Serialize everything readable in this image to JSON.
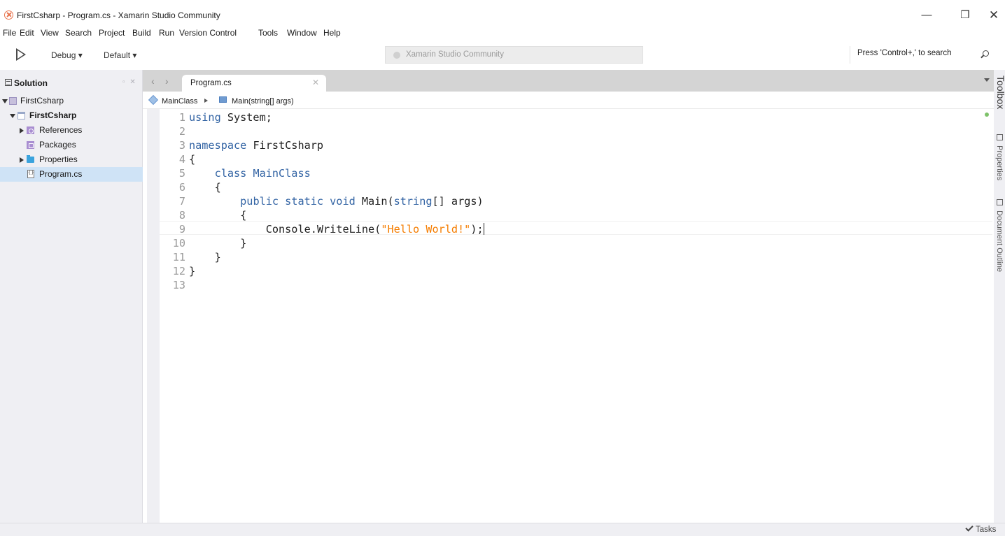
{
  "window": {
    "title": "FirstCsharp - Program.cs - Xamarin Studio Community",
    "minimize": "—",
    "maximize": "❐",
    "close": "✕"
  },
  "menu": {
    "items": [
      "File",
      "Edit",
      "View",
      "Search",
      "Project",
      "Build",
      "Run",
      "Version Control",
      "Tools",
      "Window",
      "Help"
    ]
  },
  "toolbar": {
    "run_icon": "play-icon",
    "configuration": "Debug ▾",
    "platform": "Default ▾",
    "status_text": "Xamarin Studio Community",
    "search_placeholder": "Press 'Control+,' to search",
    "search_icon": "search-icon"
  },
  "solution": {
    "title": "Solution",
    "pad_controls": "▫ ✕",
    "items": [
      {
        "label": "FirstCsharp",
        "icon": "solution-icon",
        "expanded": true
      },
      {
        "label": "FirstCsharp",
        "icon": "project-icon",
        "expanded": true
      },
      {
        "label": "References",
        "icon": "references-icon",
        "expanded": false
      },
      {
        "label": "Packages",
        "icon": "packages-icon"
      },
      {
        "label": "Properties",
        "icon": "folder-icon",
        "expanded": false
      },
      {
        "label": "Program.cs",
        "icon": "csharp-file-icon",
        "selected": true
      }
    ]
  },
  "tabs": {
    "back": "‹",
    "forward": "›",
    "active": "Program.cs",
    "close": "✕"
  },
  "breadcrumb": {
    "class_name": "MainClass",
    "method_name": "Main(string[] args)"
  },
  "editor": {
    "current_line": 9,
    "lines": [
      {
        "n": "1",
        "tokens": [
          [
            "kw",
            "using"
          ],
          [
            "id",
            " System;"
          ]
        ]
      },
      {
        "n": "2",
        "tokens": []
      },
      {
        "n": "3",
        "tokens": [
          [
            "kw",
            "namespace"
          ],
          [
            "id",
            " FirstCsharp"
          ]
        ]
      },
      {
        "n": "4",
        "tokens": [
          [
            "punc",
            "{"
          ]
        ]
      },
      {
        "n": "5",
        "tokens": [
          [
            "id",
            "    "
          ],
          [
            "kw",
            "class"
          ],
          [
            "kw",
            " MainClass"
          ]
        ]
      },
      {
        "n": "6",
        "tokens": [
          [
            "punc",
            "    {"
          ]
        ]
      },
      {
        "n": "7",
        "tokens": [
          [
            "id",
            "        "
          ],
          [
            "kw",
            "public static void"
          ],
          [
            "id",
            " Main("
          ],
          [
            "kw",
            "string"
          ],
          [
            "id",
            "[] args)"
          ]
        ]
      },
      {
        "n": "8",
        "tokens": [
          [
            "punc",
            "        {"
          ]
        ]
      },
      {
        "n": "9",
        "tokens": [
          [
            "id",
            "            Console.WriteLine("
          ],
          [
            "str",
            "\"Hello World!\""
          ],
          [
            "id",
            ");"
          ]
        ]
      },
      {
        "n": "10",
        "tokens": [
          [
            "punc",
            "        }"
          ]
        ]
      },
      {
        "n": "11",
        "tokens": [
          [
            "punc",
            "    }"
          ]
        ]
      },
      {
        "n": "12",
        "tokens": [
          [
            "punc",
            "}"
          ]
        ]
      },
      {
        "n": "13",
        "tokens": []
      }
    ]
  },
  "right_dock": {
    "toolbox": "Toolbox",
    "properties": "Properties",
    "outline": "Document Outline"
  },
  "statusbar": {
    "tasks": "Tasks"
  },
  "colors": {
    "keyword": "#3364a4",
    "string": "#f57d00",
    "selection": "#cfe3f6",
    "pad_background": "#efeff3"
  }
}
